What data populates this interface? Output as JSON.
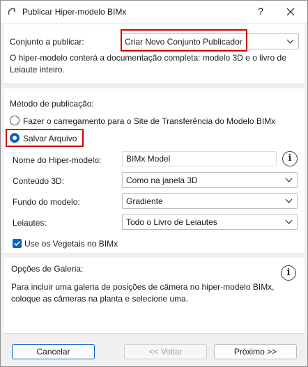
{
  "window": {
    "title": "Publicar Hiper-modelo BIMx",
    "help_label": "?"
  },
  "set": {
    "label": "Conjunto a publicar:",
    "value": "Criar Novo Conjunto Publicador",
    "description": "O hiper-modelo conterá a documentação completa: modelo 3D e o livro de Leiaute inteiro."
  },
  "method": {
    "label": "Método de publicação:",
    "options": [
      {
        "label": "Fazer o carregamento para o Site de Transferência do Modelo BIMx",
        "selected": false
      },
      {
        "label": "Salvar Arquivo",
        "selected": true
      }
    ]
  },
  "fields": {
    "name_label": "Nome do Hiper-modelo:",
    "name_value": "BIMx Model",
    "content3d_label": "Conteúdo 3D:",
    "content3d_value": "Como na janela 3D",
    "background_label": "Fundo do modelo:",
    "background_value": "Gradiente",
    "layouts_label": "Leiautes:",
    "layouts_value": "Todo o Livro de Leiautes",
    "vegetation_label": "Use os Vegetais no BIMx",
    "vegetation_checked": true
  },
  "gallery": {
    "label": "Opções de Galeria:",
    "description": "Para incluir uma galeria de posições de câmera no hiper-modelo BIMx, coloque as câmeras na planta e selecione uma."
  },
  "buttons": {
    "cancel": "Cancelar",
    "back": "<< Voltar",
    "next": "Próximo >>"
  },
  "colors": {
    "accent": "#0a64c8",
    "highlight": "#d40000"
  },
  "icons": {
    "title": "bimx-app-icon",
    "close": "close-icon",
    "dropdown": "chevron-down-icon",
    "info": "info-icon"
  }
}
